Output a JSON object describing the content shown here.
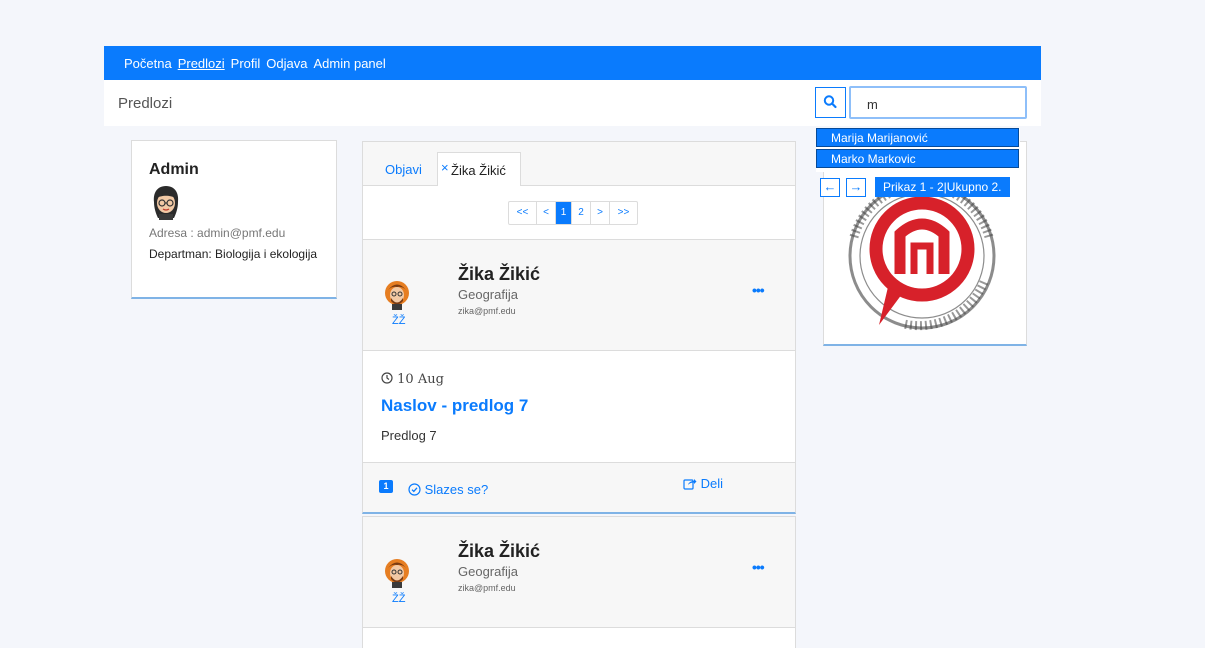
{
  "navbar": {
    "items": [
      "Početna",
      "Predlozi",
      "Profil",
      "Odjava",
      "Admin panel"
    ]
  },
  "header": {
    "title": "Predlozi"
  },
  "search": {
    "value": "m",
    "icon": "search-icon"
  },
  "dropdown": {
    "results": [
      "Marija Marijanović",
      "Marko Markovic"
    ],
    "prev": "←",
    "next": "→",
    "info": "Prikaz 1 - 2|Ukupno 2."
  },
  "profile": {
    "name": "Admin",
    "address": "Adresa : admin@pmf.edu",
    "department": "Departman: Biologija i ekologija"
  },
  "tabs": {
    "first": "Objavi",
    "second": "Žika Žikić",
    "close": "×"
  },
  "pagination": {
    "first": "<<",
    "prev": "<",
    "pages": [
      "1",
      "2"
    ],
    "next": ">",
    "last": ">>",
    "current": "1"
  },
  "posts": [
    {
      "author": "Žika Žikić",
      "department": "Geografija",
      "email": "zika@pmf.edu",
      "initials": "ŽŽ",
      "more": "•••",
      "date": "10 Aug",
      "title": "Naslov - predlog 7",
      "text": "Predlog 7",
      "count": "1",
      "agree": "Slazes se?",
      "share": "Deli"
    },
    {
      "author": "Žika Žikić",
      "department": "Geografija",
      "email": "zika@pmf.edu",
      "initials": "ŽŽ",
      "more": "•••"
    }
  ],
  "colors": {
    "primary": "#0a7bfd",
    "logo_red": "#d7212a"
  }
}
